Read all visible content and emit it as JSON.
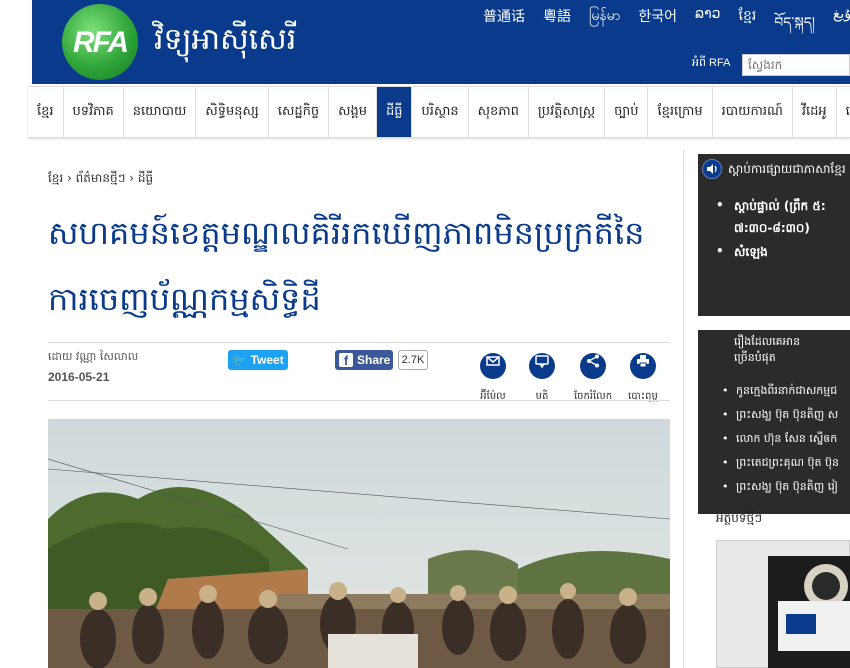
{
  "header": {
    "logo_text": "RFA",
    "site_name": "វិទ្យុអាស៊ីសេរី",
    "languages": [
      "普通话",
      "粵語",
      "မြန်မာ",
      "한국어",
      "ລາວ",
      "ខ្មែរ",
      "བོད་སྐད།",
      "ئۇيغ"
    ],
    "about_label": "អំពី RFA",
    "search_placeholder": "ស្វែងរក"
  },
  "nav": {
    "items": [
      "ខ្មែរ",
      "បទវិភាគ",
      "នយោបាយ",
      "សិទ្ធិមនុស្ស",
      "សេដ្ឋកិច្ច",
      "សង្គម",
      "ដីធ្លី",
      "បរិស្ថាន",
      "សុខភាព",
      "ប្រវត្តិសាស្ត្រ",
      "ច្បាប់",
      "ខ្មែរក្រោម",
      "របាយការណ៍",
      "វីដេអូ",
      "វេទិកា"
    ],
    "active_index": 6
  },
  "article": {
    "breadcrumb": "ខ្មែរ › ព័ត៌មានថ្មីៗ › ដីធ្លី",
    "title": "សហគមន៍ខេត្តមណ្ឌលគិរីរកឃើញភាពមិនប្រក្រតីនៃការចេញប័ណ្ណកម្មសិទ្ធិដី",
    "author": "ដោយ វណ្ណា សៃលាល",
    "date": "2016-05-21",
    "tweet_label": "Tweet",
    "share_label": "Share",
    "share_count": "2.7K",
    "tools": [
      "អ៊ីម៉ែល",
      "មតិ",
      "ចែករំលែក",
      "បោះពុម្ព"
    ]
  },
  "sidebar": {
    "radio_title": "ស្តាប់ការផ្សាយជាភាសាខ្មែរ",
    "radio_items": [
      "ស្តាប់ផ្ទាល់ (ព្រឹក ៥:",
      "៧:៣០-៨:៣០)",
      "សំឡេង"
    ],
    "popular_title": "រឿងដែលគេអានច្រើនបំផុត",
    "popular_items": [
      "កូនក្មេងពីរនាក់ជាសកម្មជ",
      "ព្រះសង្ឃ ប៊ុត ប៊ុនតិញ ស",
      "លោក ហ៊ុន សែន ស្នើឲក",
      "ព្រះតេជព្រះគុណ ប៊ុត ប៊ុន",
      "ព្រះសង្ឃ ប៊ុត ប៊ុនតិញ រៀ"
    ],
    "fb_caption": "អត្ថបទថ្មីៗ"
  },
  "colors": {
    "brand_blue": "#0a3a8c",
    "sidebar_dark": "#2b2b2b",
    "twitter": "#1da1f2",
    "facebook": "#3b5998"
  }
}
